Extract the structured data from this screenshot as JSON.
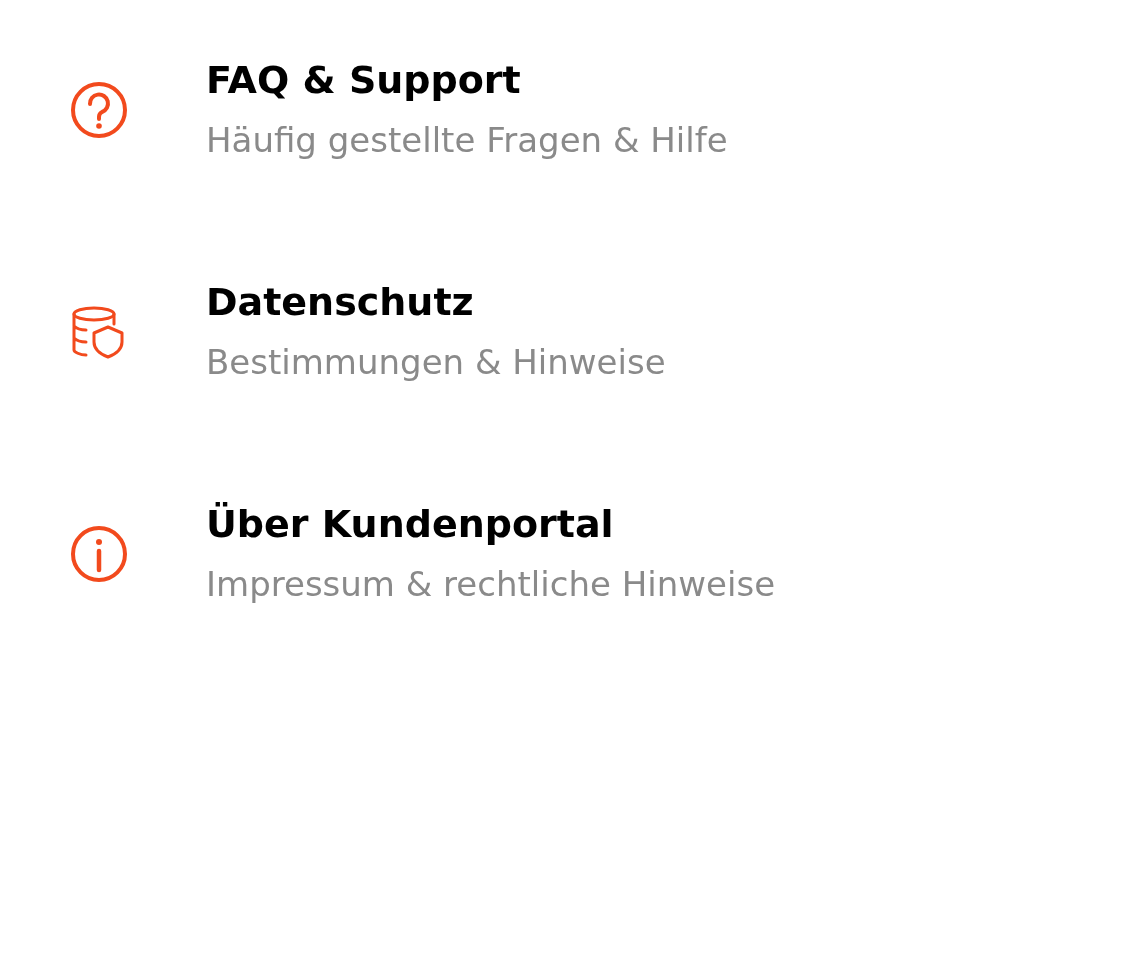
{
  "menu_items": [
    {
      "kind": "help",
      "title": "FAQ & Support",
      "subtitle": "Häufig gestellte Fragen & Hilfe"
    },
    {
      "kind": "privacy",
      "title": "Datenschutz",
      "subtitle": "Bestimmungen & Hinweise"
    },
    {
      "kind": "info",
      "title": "Über Kundenportal",
      "subtitle": "Impressum & rechtliche Hinweise"
    }
  ]
}
